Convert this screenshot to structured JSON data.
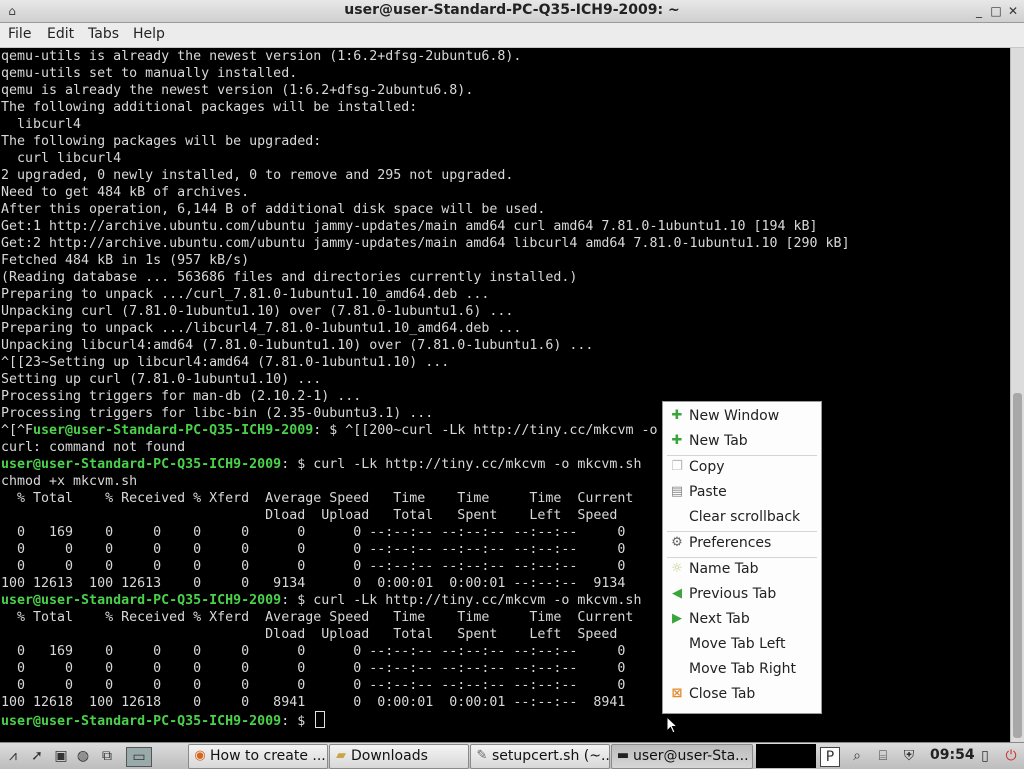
{
  "window": {
    "title": "user@user-Standard-PC-Q35-ICH9-2009: ~",
    "buttons": [
      "minimize",
      "maximize",
      "close"
    ]
  },
  "menubar": {
    "items": [
      "File",
      "Edit",
      "Tabs",
      "Help"
    ]
  },
  "terminal": {
    "prompt": "user@user-Standard-PC-Q35-ICH9-2009",
    "lines": [
      {
        "text": "qemu-utils is already the newest version (1:6.2+dfsg-2ubuntu6.8)."
      },
      {
        "text": "qemu-utils set to manually installed."
      },
      {
        "text": "qemu is already the newest version (1:6.2+dfsg-2ubuntu6.8)."
      },
      {
        "text": "The following additional packages will be installed:"
      },
      {
        "text": "  libcurl4"
      },
      {
        "text": "The following packages will be upgraded:"
      },
      {
        "text": "  curl libcurl4"
      },
      {
        "text": "2 upgraded, 0 newly installed, 0 to remove and 295 not upgraded."
      },
      {
        "text": "Need to get 484 kB of archives."
      },
      {
        "text": "After this operation, 6,144 B of additional disk space will be used."
      },
      {
        "text": "Get:1 http://archive.ubuntu.com/ubuntu jammy-updates/main amd64 curl amd64 7.81.0-1ubuntu1.10 [194 kB]"
      },
      {
        "text": "Get:2 http://archive.ubuntu.com/ubuntu jammy-updates/main amd64 libcurl4 amd64 7.81.0-1ubuntu1.10 [290 kB]"
      },
      {
        "text": "Fetched 484 kB in 1s (957 kB/s)"
      },
      {
        "text": "(Reading database ... 563686 files and directories currently installed.)"
      },
      {
        "text": "Preparing to unpack .../curl_7.81.0-1ubuntu1.10_amd64.deb ..."
      },
      {
        "text": "Unpacking curl (7.81.0-1ubuntu1.10) over (7.81.0-1ubuntu1.6) ..."
      },
      {
        "text": "Preparing to unpack .../libcurl4_7.81.0-1ubuntu1.10_amd64.deb ..."
      },
      {
        "text": "Unpacking libcurl4:amd64 (7.81.0-1ubuntu1.10) over (7.81.0-1ubuntu1.6) ..."
      },
      {
        "text": "^[[23~Setting up libcurl4:amd64 (7.81.0-1ubuntu1.10) ..."
      },
      {
        "text": "Setting up curl (7.81.0-1ubuntu1.10) ..."
      },
      {
        "text": "Processing triggers for man-db (2.10.2-1) ..."
      },
      {
        "text": "Processing triggers for libc-bin (2.35-0ubuntu3.1) ..."
      },
      {
        "pre": "^[^F",
        "prompt": "user@user-Standard-PC-Q35-ICH9-2009",
        "text": ": $ ^[[200~curl -Lk http://tiny.cc/mkcvm -o"
      },
      {
        "text": "curl: command not found"
      },
      {
        "prompt": "user@user-Standard-PC-Q35-ICH9-2009",
        "text": ": $ curl -Lk http://tiny.cc/mkcvm -o mkcvm.sh"
      },
      {
        "text": "chmod +x mkcvm.sh"
      },
      {
        "text": "  % Total    % Received % Xferd  Average Speed   Time    Time     Time  Current"
      },
      {
        "text": "                                 Dload  Upload   Total   Spent    Left  Speed"
      },
      {
        "text": "  0   169    0     0    0     0      0      0 --:--:-- --:--:-- --:--:--     0"
      },
      {
        "text": "  0     0    0     0    0     0      0      0 --:--:-- --:--:-- --:--:--     0"
      },
      {
        "text": "  0     0    0     0    0     0      0      0 --:--:-- --:--:-- --:--:--     0"
      },
      {
        "text": "100 12613  100 12613    0     0   9134      0  0:00:01  0:00:01 --:--:--  9134"
      },
      {
        "prompt": "user@user-Standard-PC-Q35-ICH9-2009",
        "text": ": $ curl -Lk http://tiny.cc/mkcvm -o mkcvm.sh"
      },
      {
        "text": "  % Total    % Received % Xferd  Average Speed   Time    Time     Time  Current"
      },
      {
        "text": "                                 Dload  Upload   Total   Spent    Left  Speed"
      },
      {
        "text": "  0   169    0     0    0     0      0      0 --:--:-- --:--:-- --:--:--     0"
      },
      {
        "text": "  0     0    0     0    0     0      0      0 --:--:-- --:--:-- --:--:--     0"
      },
      {
        "text": "  0     0    0     0    0     0      0      0 --:--:-- --:--:-- --:--:--     0"
      },
      {
        "text": "100 12618  100 12618    0     0   8941      0  0:00:01  0:00:01 --:--:--  8941"
      },
      {
        "prompt": "user@user-Standard-PC-Q35-ICH9-2009",
        "text": ": $ ",
        "cursor": true
      }
    ]
  },
  "context_menu": {
    "items": [
      {
        "label": "New Window",
        "icon": "plus-icon"
      },
      {
        "label": "New Tab",
        "icon": "plus-icon"
      },
      {
        "label": "Copy",
        "icon": "copy-icon"
      },
      {
        "label": "Paste",
        "icon": "paste-icon"
      },
      {
        "label": "Clear scrollback",
        "icon": ""
      },
      {
        "label": "Preferences",
        "icon": "preferences-icon"
      },
      {
        "label": "Name Tab",
        "icon": "lightbulb-icon"
      },
      {
        "label": "Previous Tab",
        "icon": "arrow-left-icon"
      },
      {
        "label": "Next Tab",
        "icon": "arrow-right-icon"
      },
      {
        "label": "Move Tab Left",
        "icon": ""
      },
      {
        "label": "Move Tab Right",
        "icon": ""
      },
      {
        "label": "Close Tab",
        "icon": "close-tab-icon"
      }
    ]
  },
  "taskbar": {
    "tasks": [
      {
        "label": "How to create ...",
        "icon": "firefox-icon"
      },
      {
        "label": "Downloads",
        "icon": "folder-icon"
      },
      {
        "label": "setupcert.sh (~...",
        "icon": "text-editor-icon"
      },
      {
        "label": "user@user-Sta...",
        "icon": "terminal-icon"
      }
    ],
    "clock": "09:54"
  },
  "colors": {
    "prompt": "#4ad24a",
    "terminal_bg": "#000000",
    "terminal_fg": "#d8d8d8"
  }
}
